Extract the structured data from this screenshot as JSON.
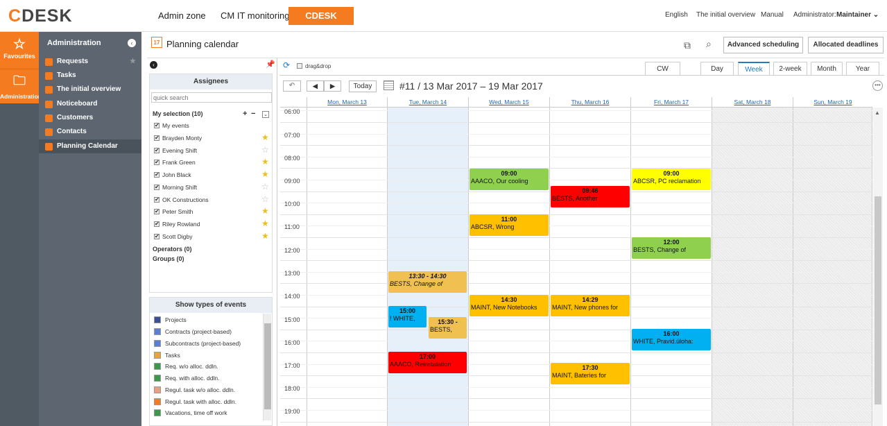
{
  "brand": {
    "c": "C",
    "rest": "DESK"
  },
  "topnav": {
    "admin": "Admin zone",
    "cmit": "CM IT monitoring",
    "cdesk": "CDESK"
  },
  "toplinks": {
    "lang": "English",
    "overview": "The initial overview",
    "manual": "Manual",
    "admin_label": "Administrator:",
    "admin_user": "Maintainer"
  },
  "leftnav": {
    "favourites": "Favourites",
    "administration": "Administration"
  },
  "menu": {
    "title": "Administration",
    "items": [
      "Requests",
      "Tasks",
      "The initial overview",
      "Noticeboard",
      "Customers",
      "Contacts",
      "Planning Calendar"
    ]
  },
  "page": {
    "title": "Planning calendar",
    "adv": "Advanced scheduling",
    "alloc": "Allocated deadlines"
  },
  "assignees": {
    "title": "Assignees",
    "search_placeholder": "quick search",
    "my_selection": "My selection (10)",
    "operators": "Operators (0)",
    "groups": "Groups (0)",
    "items": [
      {
        "name": "My events",
        "star": ""
      },
      {
        "name": "Brayden Monty",
        "star": "on"
      },
      {
        "name": "Evening Shift",
        "star": "off"
      },
      {
        "name": "Frank Green",
        "star": "on"
      },
      {
        "name": "John Black",
        "star": "on"
      },
      {
        "name": "Morning Shift",
        "star": "off"
      },
      {
        "name": "OK Constructions",
        "star": "off"
      },
      {
        "name": "Peter Smith",
        "star": "on"
      },
      {
        "name": "Riley Rowland",
        "star": "on"
      },
      {
        "name": "Scott Digby",
        "star": "on"
      }
    ]
  },
  "types": {
    "title": "Show types of events",
    "items": [
      {
        "name": "Projects",
        "color": "#3a4e9a"
      },
      {
        "name": "Contracts (project-based)",
        "color": "#5b7fd6"
      },
      {
        "name": "Subcontracts (project-based)",
        "color": "#5b7fd6"
      },
      {
        "name": "Tasks",
        "color": "#e8a43a"
      },
      {
        "name": "Req. w/o alloc. ddln.",
        "color": "#3a9a4a"
      },
      {
        "name": "Req. with alloc. ddln.",
        "color": "#3a9a4a"
      },
      {
        "name": "Regul. task w/o alloc. ddln.",
        "color": "#e8a080"
      },
      {
        "name": "Regul. task with alloc. ddln.",
        "color": "#f47b20"
      },
      {
        "name": "Vacations, time off work",
        "color": "#3a9a4a"
      }
    ]
  },
  "calendar": {
    "dragdrop": "drag&drop",
    "today": "Today",
    "range": "#11 / 13 Mar 2017 – 19 Mar 2017",
    "tabs": [
      "CW",
      "Day",
      "Week",
      "2-week",
      "Month",
      "Year"
    ],
    "active_tab": "Week",
    "days": [
      "Mon, March 13",
      "Tue, March 14",
      "Wed, March 15",
      "Thu, March 16",
      "Fri, March 17",
      "Sat, March 18",
      "Sun, March 19"
    ],
    "hours": [
      "06:00",
      "07:00",
      "08:00",
      "09:00",
      "10:00",
      "11:00",
      "12:00",
      "13:00",
      "14:00",
      "15:00",
      "16:00",
      "17:00",
      "18:00",
      "19:00"
    ]
  },
  "events": [
    {
      "day": 2,
      "time": "09:00",
      "text": "AAACO, Our cooling",
      "color": "#8fd14f"
    },
    {
      "day": 3,
      "time": "09:46",
      "text": "BESTS, Another",
      "color": "#ff0000"
    },
    {
      "day": 4,
      "time": "09:00",
      "text": "ABCSR, PC reclamation",
      "color": "#ffff00"
    },
    {
      "day": 2,
      "time": "11:00",
      "text": "ABCSR, Wrong",
      "color": "#ffc000"
    },
    {
      "day": 4,
      "time": "12:00",
      "text": "BESTS, Change of",
      "color": "#8fd14f"
    },
    {
      "day": 1,
      "time": "13:30 - 14:30",
      "text": "BESTS, Change of",
      "color": "#f0c050"
    },
    {
      "day": 2,
      "time": "14:30",
      "text": "MAINT, New Notebooks",
      "color": "#ffc000"
    },
    {
      "day": 3,
      "time": "14:29",
      "text": "MAINT, New phones for",
      "color": "#ffc000"
    },
    {
      "day": 1,
      "time": "15:00",
      "text": "! WHITE,",
      "color": "#00b0f0"
    },
    {
      "day": 1,
      "time": "15:30 -",
      "text": "BESTS,",
      "color": "#f0c050"
    },
    {
      "day": 4,
      "time": "16:00",
      "text": "WHITE, Pravid.úloha:",
      "color": "#00b0f0"
    },
    {
      "day": 1,
      "time": "17:00",
      "text": "AAACO, Reinstalation",
      "color": "#ff0000"
    },
    {
      "day": 3,
      "time": "17:30",
      "text": "MAINT, Bateries for",
      "color": "#ffc000"
    }
  ]
}
